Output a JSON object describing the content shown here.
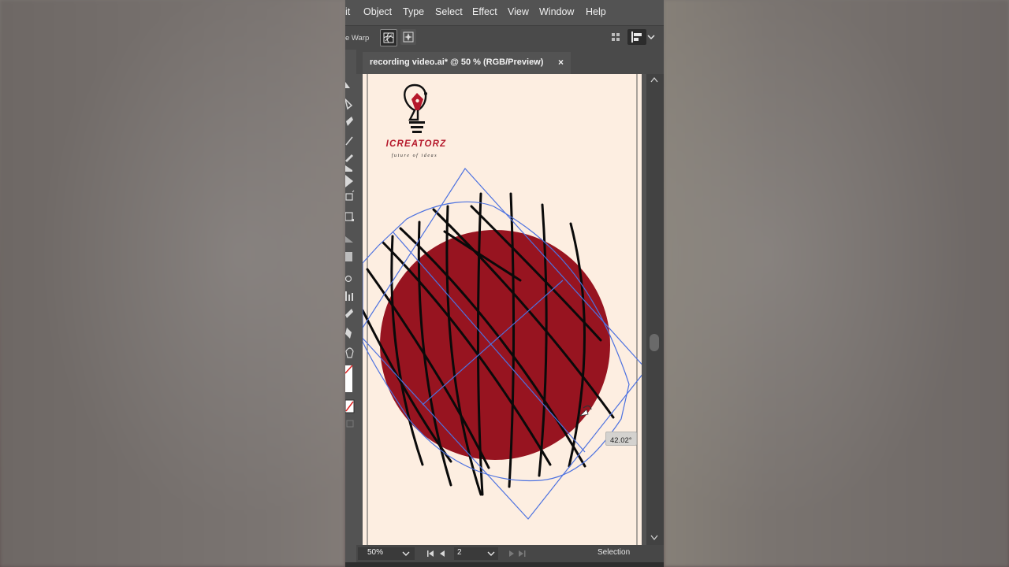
{
  "menu": {
    "items": [
      "it",
      "Object",
      "Type",
      "Select",
      "Effect",
      "View",
      "Window",
      "Help"
    ]
  },
  "control_bar": {
    "warp_label": "e Warp"
  },
  "document_tab": {
    "title": "recording video.ai* @ 50 % (RGB/Preview)",
    "close_glyph": "×"
  },
  "artwork": {
    "logo_title": "ICREATORZ",
    "logo_tagline": "future of ideas",
    "rotation_readout": "42.02°",
    "circle_color": "#971420",
    "artboard_color": "#fdeee1",
    "selection_color": "#4d72e0",
    "logo_title_color": "#b5182b"
  },
  "status_bar": {
    "zoom": "50%",
    "artboard_number": "2",
    "current_tool": "Selection"
  },
  "icons": {
    "close": "close-icon",
    "chevron": "chevron-down-icon",
    "first": "first-artboard-icon",
    "prev": "previous-artboard-icon",
    "next": "next-artboard-icon",
    "last": "last-artboard-icon"
  }
}
